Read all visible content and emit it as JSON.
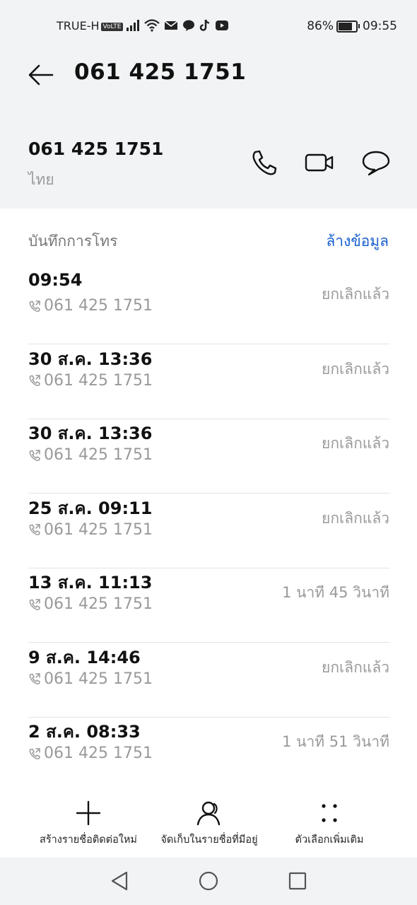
{
  "status_bar": {
    "carrier": "TRUE-H",
    "volte": "VoLTE",
    "battery": "86%",
    "battery_level": 0.86,
    "time": "09:55"
  },
  "header": {
    "title": "061 425 1751"
  },
  "contact": {
    "number": "061 425 1751",
    "country": "ไทย",
    "actions": [
      "phone-icon",
      "video-call-icon",
      "message-icon"
    ]
  },
  "call_log": {
    "heading": "บันทึกการโทร",
    "clear_label": "ล้างข้อมูล",
    "entries": [
      {
        "time": "09:54",
        "number": "061 425 1751",
        "status": "ยกเลิกแล้ว"
      },
      {
        "time": "30 ส.ค. 13:36",
        "number": "061 425 1751",
        "status": "ยกเลิกแล้ว"
      },
      {
        "time": "30 ส.ค. 13:36",
        "number": "061 425 1751",
        "status": "ยกเลิกแล้ว"
      },
      {
        "time": "25 ส.ค. 09:11",
        "number": "061 425 1751",
        "status": "ยกเลิกแล้ว"
      },
      {
        "time": "13 ส.ค. 11:13",
        "number": "061 425 1751",
        "status": "1 นาที 45 วินาที"
      },
      {
        "time": "9 ส.ค. 14:46",
        "number": "061 425 1751",
        "status": "ยกเลิกแล้ว"
      },
      {
        "time": "2 ส.ค. 08:33",
        "number": "061 425 1751",
        "status": "1 นาที 51 วินาที"
      }
    ]
  },
  "bottom_actions": {
    "create_contact": "สร้างรายชื่อติดต่อใหม่",
    "save_existing": "จัดเก็บในรายชื่อที่มีอยู่",
    "more_options": "ตัวเลือกเพิ่มเติม"
  },
  "colors": {
    "accent": "#1a5fd0",
    "background": "#f1f3f5",
    "secondary_text": "#999999"
  }
}
